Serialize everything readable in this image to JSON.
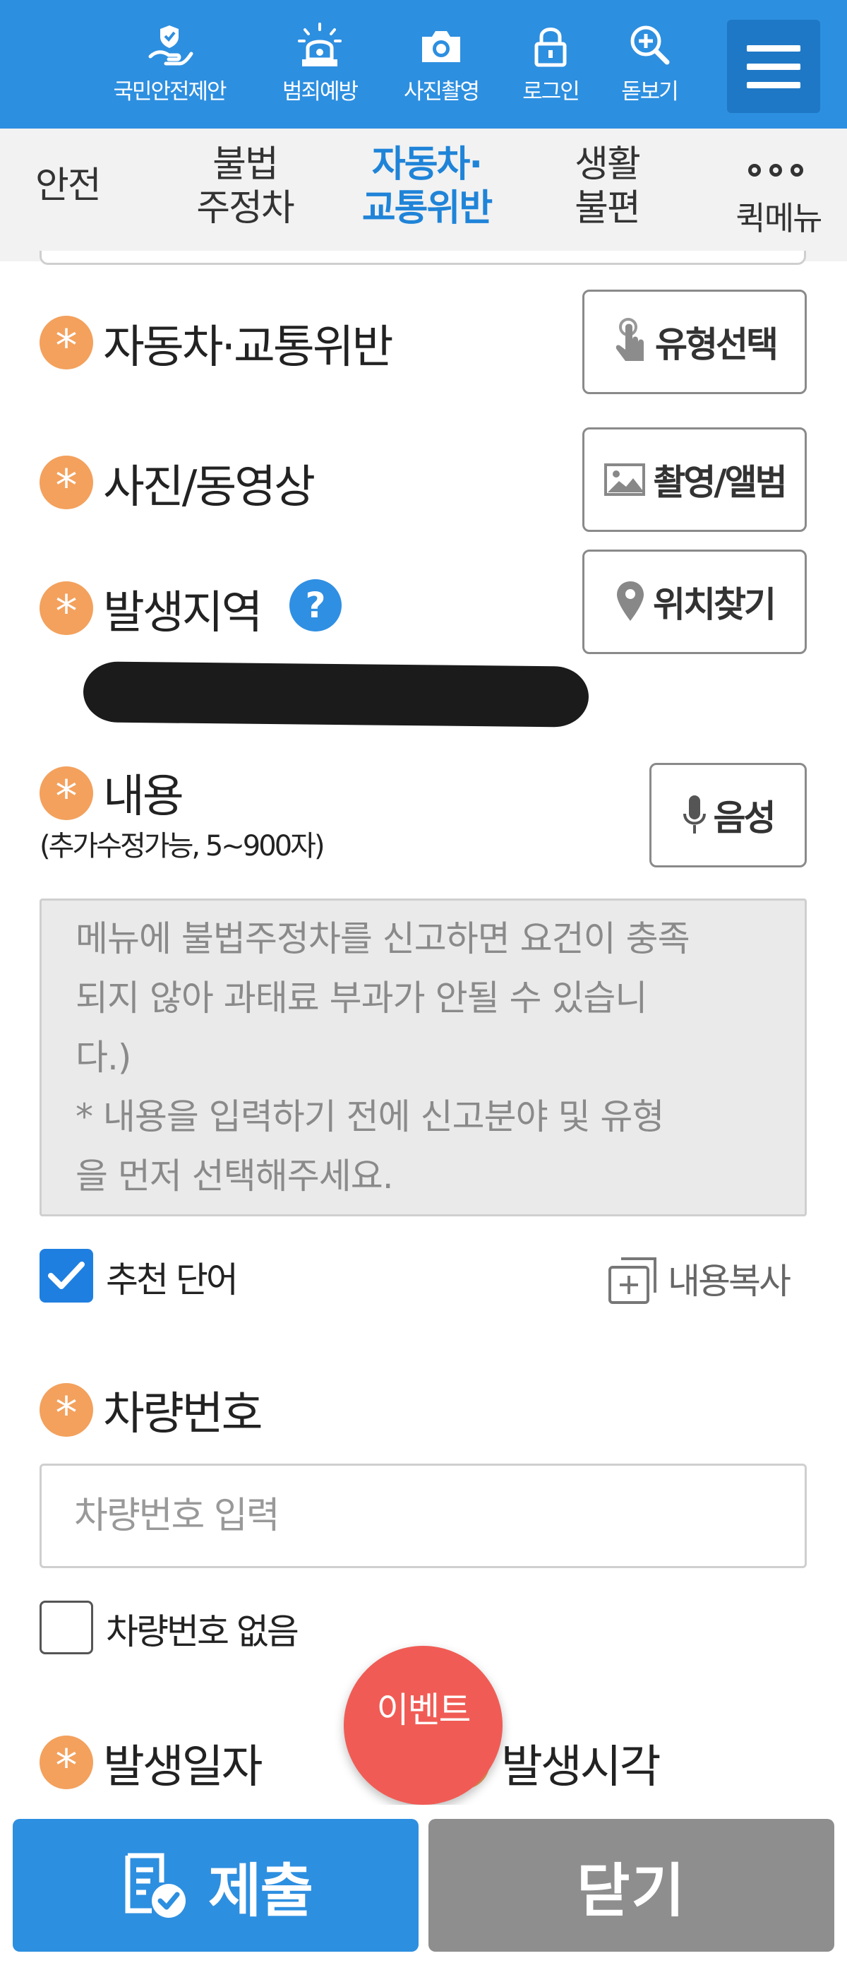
{
  "toolbar": {
    "items": [
      {
        "label": "국민안전제안",
        "icon": "hand-shield-icon"
      },
      {
        "label": "범죄예방",
        "icon": "siren-icon"
      },
      {
        "label": "사진촬영",
        "icon": "camera-icon"
      },
      {
        "label": "로그인",
        "icon": "lock-icon"
      },
      {
        "label": "돋보기",
        "icon": "magnifier-plus-icon"
      }
    ],
    "menu_icon": "hamburger-menu-icon"
  },
  "tabs": [
    {
      "line1": "안전",
      "line2": ""
    },
    {
      "line1": "불법",
      "line2": "주정차"
    },
    {
      "line1": "자동차·",
      "line2": "교통위반",
      "active": true
    },
    {
      "line1": "생활",
      "line2": "불편"
    },
    {
      "line1": "",
      "line2": "퀵메뉴",
      "icon": "more-dots-icon"
    }
  ],
  "form": {
    "required_mark": "*",
    "category": {
      "label": "자동차·교통위반",
      "button": "유형선택",
      "button_icon": "touch-hand-icon"
    },
    "media": {
      "label": "사진/동영상",
      "button": "촬영/앨범",
      "button_icon": "image-icon"
    },
    "location": {
      "label": "발생지역",
      "help": "?",
      "button": "위치찾기",
      "button_icon": "map-pin-icon"
    },
    "content": {
      "label": "내용",
      "sublabel": "(추가수정가능, 5~900자)",
      "button": "음성",
      "button_icon": "microphone-icon",
      "lines": [
        "메뉴에 불법주정차를 신고하면 요건이 충족",
        "되지 않아 과태료 부과가 안될 수 있습니",
        "다.)",
        "* 내용을 입력하기 전에 신고분야 및 유형",
        "을 먼저 선택해주세요."
      ]
    },
    "recommend": {
      "label": "추천 단어",
      "checked": true
    },
    "copy": {
      "label": "내용복사",
      "icon": "copy-plus-icon"
    },
    "plate": {
      "label": "차량번호",
      "placeholder": "차량번호 입력"
    },
    "no_plate": {
      "label": "차량번호 없음",
      "checked": false
    },
    "date": {
      "label": "발생일자"
    },
    "time": {
      "label": "발생시각"
    }
  },
  "event_button": "이벤트",
  "footer": {
    "submit": "제출",
    "submit_icon": "document-check-icon",
    "close": "닫기"
  },
  "colors": {
    "primary": "#2d8fe0",
    "accent_star": "#f3a15d",
    "event": "#f05c55",
    "close_gray": "#8e8e8e"
  }
}
